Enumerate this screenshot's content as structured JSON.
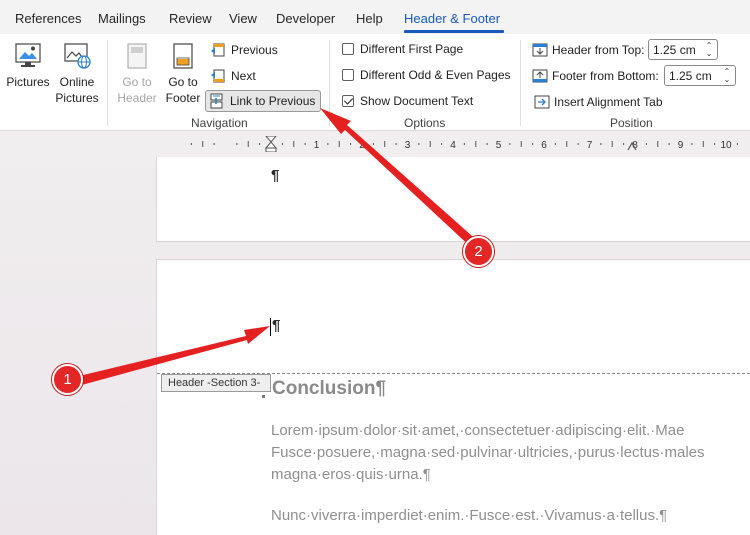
{
  "tabs": [
    {
      "label": "References"
    },
    {
      "label": "Mailings"
    },
    {
      "label": "Review"
    },
    {
      "label": "View"
    },
    {
      "label": "Developer"
    },
    {
      "label": "Help"
    },
    {
      "label": "Header & Footer"
    }
  ],
  "ribbon": {
    "insert": {
      "pictures": "Pictures",
      "online_pictures_1": "Online",
      "online_pictures_2": "Pictures"
    },
    "navigation": {
      "go_to_header_1": "Go to",
      "go_to_header_2": "Header",
      "go_to_footer_1": "Go to",
      "go_to_footer_2": "Footer",
      "previous": "Previous",
      "next": "Next",
      "link_to_previous": "Link to Previous",
      "label": "Navigation"
    },
    "options": {
      "different_first_page": "Different First Page",
      "different_first_page_checked": false,
      "different_odd_even": "Different Odd & Even Pages",
      "different_odd_even_checked": false,
      "show_document_text": "Show Document Text",
      "show_document_text_checked": true,
      "label": "Options"
    },
    "position": {
      "header_from_top": "Header from Top:",
      "header_from_top_value": "1.25 cm",
      "footer_from_bottom": "Footer from Bottom:",
      "footer_from_bottom_value": "1.25 cm",
      "insert_alignment_tab": "Insert Alignment Tab",
      "label": "Position"
    }
  },
  "ruler": {
    "numbers": [
      "1",
      "2",
      "3",
      "4",
      "5",
      "6",
      "7",
      "8",
      "9",
      "10"
    ]
  },
  "document": {
    "pilcrow": "¶",
    "section_label": "Header -Section 3-",
    "heading": "Conclusion¶",
    "paragraph1": [
      "Lorem·ipsum·dolor·sit·amet,·consectetuer·adipiscing·elit.·Mae",
      "Fusce·posuere,·magna·sed·pulvinar·ultricies,·purus·lectus·males",
      "magna·eros·quis·urna.¶"
    ],
    "paragraph2": "Nunc·viverra·imperdiet·enim.·Fusce·est.·Vivamus·a·tellus.¶"
  },
  "annotations": {
    "badge1": "1",
    "badge2": "2"
  },
  "colors": {
    "accent": "#185abd",
    "annotation": "#e32626"
  }
}
